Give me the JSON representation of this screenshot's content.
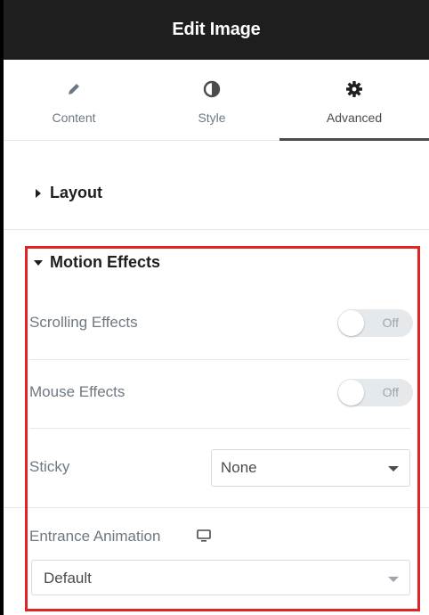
{
  "header": {
    "title": "Edit Image"
  },
  "tabs": [
    {
      "label": "Content",
      "icon": "pencil-icon",
      "active": false
    },
    {
      "label": "Style",
      "icon": "half-circle-icon",
      "active": false
    },
    {
      "label": "Advanced",
      "icon": "gear-icon",
      "active": true
    }
  ],
  "sections": {
    "layout": {
      "title": "Layout",
      "expanded": false
    },
    "motion_effects": {
      "title": "Motion Effects",
      "expanded": true,
      "highlight_color": "#e02424",
      "scrolling_effects": {
        "label": "Scrolling Effects",
        "toggle_text": "Off"
      },
      "mouse_effects": {
        "label": "Mouse Effects",
        "toggle_text": "Off"
      },
      "sticky": {
        "label": "Sticky",
        "value": "None"
      },
      "entrance_animation": {
        "label": "Entrance Animation",
        "icon": "desktop-icon",
        "value": "Default"
      }
    }
  },
  "colors": {
    "header_bg": "#1e1e1e",
    "active_tab": "#494c4f",
    "label": "#6d7882",
    "highlight": "#e02424"
  }
}
